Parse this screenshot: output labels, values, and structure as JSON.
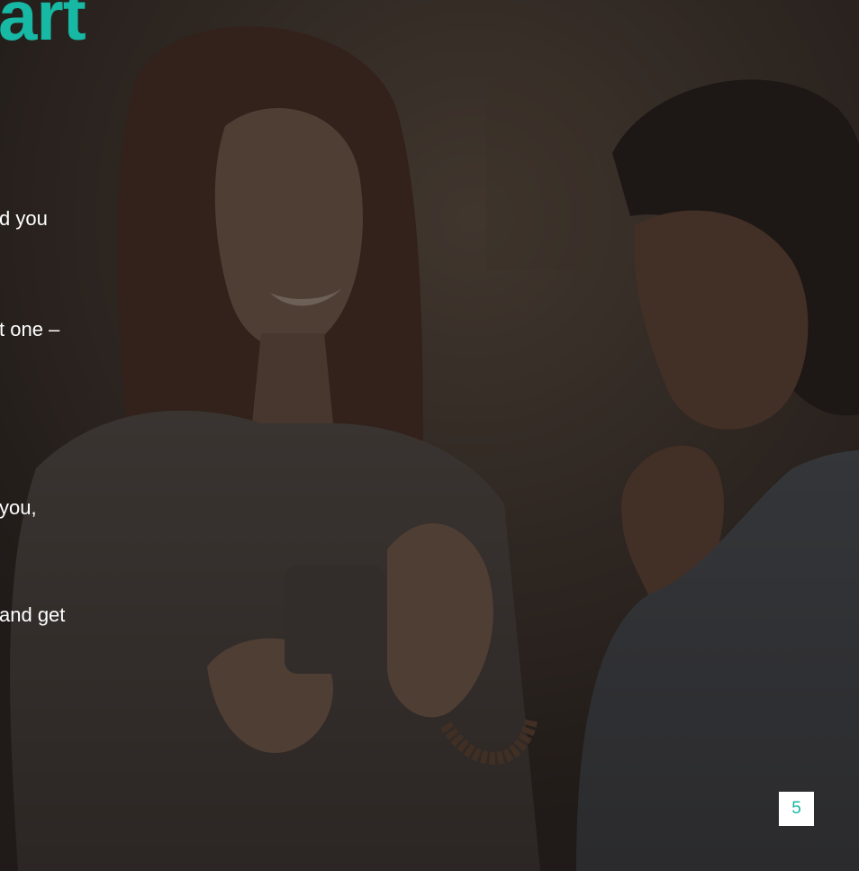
{
  "slide": {
    "title_fragment": "art",
    "text_fragments": [
      "d you",
      "t one –",
      "you,",
      " and get"
    ],
    "page_number": "5"
  },
  "colors": {
    "accent": "#17b8a4",
    "overlay": "#1f1a17",
    "text": "#ffffff"
  },
  "image": {
    "subject": "two women looking at a smartphone",
    "icon": "photo-background"
  }
}
